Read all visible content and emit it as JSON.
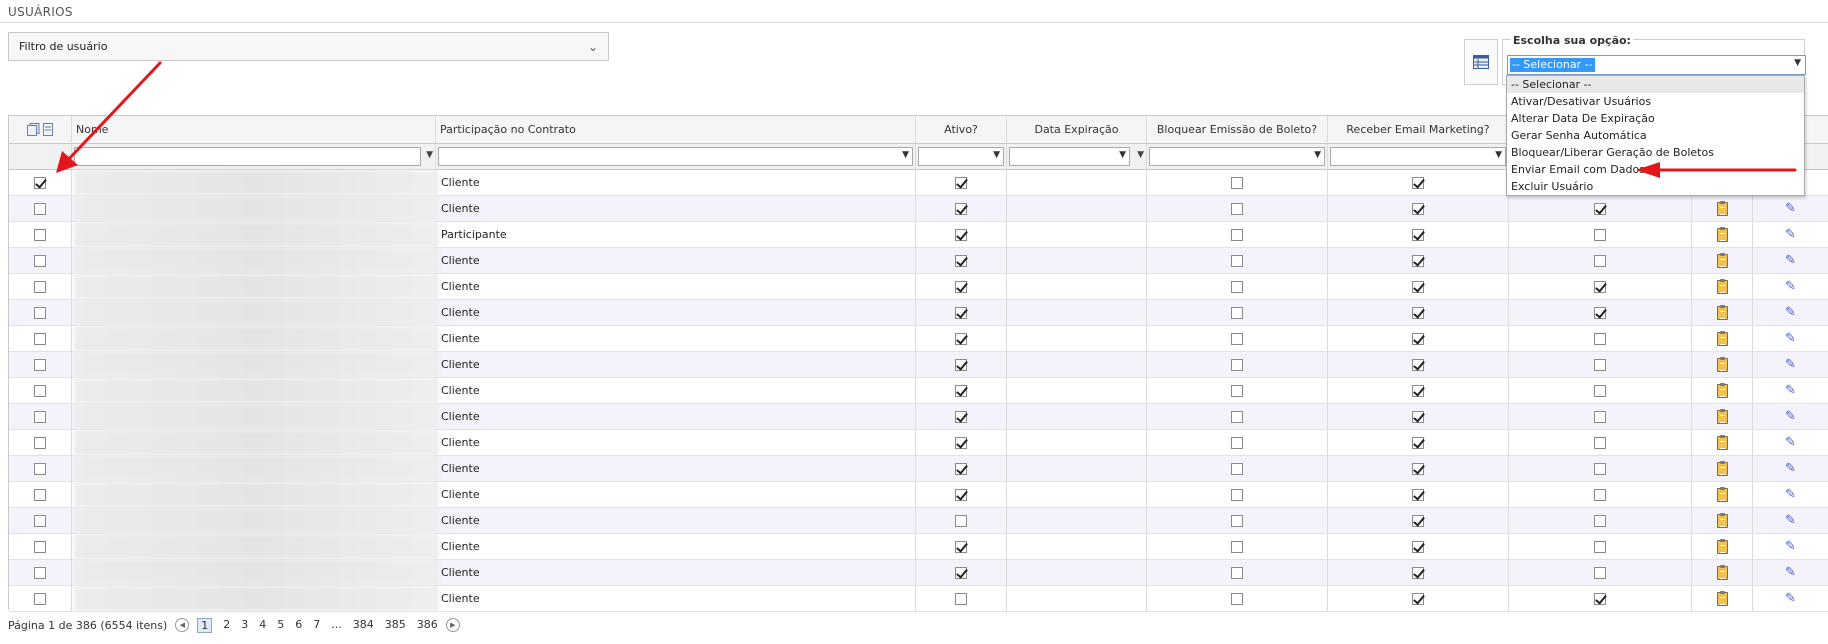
{
  "page": {
    "title": "USUÁRIOS"
  },
  "filter": {
    "label": "Filtro de usuário"
  },
  "options_panel": {
    "legend": "Escolha sua opção:",
    "selected": "-- Selecionar --",
    "items": [
      "-- Selecionar --",
      "Ativar/Desativar Usuários",
      "Alterar Data De Expiração",
      "Gerar Senha Automática",
      "Bloquear/Liberar Geração de Boletos",
      "Enviar Email com Dados",
      "Excluir Usuário"
    ]
  },
  "grid": {
    "columns": {
      "nome": "Nome",
      "participacao": "Participação no Contrato",
      "ativo": "Ativo?",
      "data_expiracao": "Data Expiração",
      "bloquear": "Bloquear Emissão de Boleto?",
      "receber": "Receber Email Marketing?"
    },
    "rows": [
      {
        "sel": true,
        "part": "Cliente",
        "ativo": true,
        "bloq": false,
        "receb": true,
        "extra": false
      },
      {
        "sel": false,
        "part": "Cliente",
        "ativo": true,
        "bloq": false,
        "receb": true,
        "extra": true
      },
      {
        "sel": false,
        "part": "Participante",
        "ativo": true,
        "bloq": false,
        "receb": true,
        "extra": false
      },
      {
        "sel": false,
        "part": "Cliente",
        "ativo": true,
        "bloq": false,
        "receb": true,
        "extra": false
      },
      {
        "sel": false,
        "part": "Cliente",
        "ativo": true,
        "bloq": false,
        "receb": true,
        "extra": true
      },
      {
        "sel": false,
        "part": "Cliente",
        "ativo": true,
        "bloq": false,
        "receb": true,
        "extra": true
      },
      {
        "sel": false,
        "part": "Cliente",
        "ativo": true,
        "bloq": false,
        "receb": true,
        "extra": false
      },
      {
        "sel": false,
        "part": "Cliente",
        "ativo": true,
        "bloq": false,
        "receb": true,
        "extra": false
      },
      {
        "sel": false,
        "part": "Cliente",
        "ativo": true,
        "bloq": false,
        "receb": true,
        "extra": false
      },
      {
        "sel": false,
        "part": "Cliente",
        "ativo": true,
        "bloq": false,
        "receb": true,
        "extra": false
      },
      {
        "sel": false,
        "part": "Cliente",
        "ativo": true,
        "bloq": false,
        "receb": true,
        "extra": false
      },
      {
        "sel": false,
        "part": "Cliente",
        "ativo": true,
        "bloq": false,
        "receb": true,
        "extra": false
      },
      {
        "sel": false,
        "part": "Cliente",
        "ativo": true,
        "bloq": false,
        "receb": true,
        "extra": false
      },
      {
        "sel": false,
        "part": "Cliente",
        "ativo": false,
        "bloq": false,
        "receb": true,
        "extra": false
      },
      {
        "sel": false,
        "part": "Cliente",
        "ativo": true,
        "bloq": false,
        "receb": true,
        "extra": false
      },
      {
        "sel": false,
        "part": "Cliente",
        "ativo": true,
        "bloq": false,
        "receb": true,
        "extra": false
      },
      {
        "sel": false,
        "part": "Cliente",
        "ativo": false,
        "bloq": false,
        "receb": true,
        "extra": true
      }
    ]
  },
  "pager": {
    "summary": "Página 1 de 386 (6554 itens)",
    "pages": [
      "1",
      "2",
      "3",
      "4",
      "5",
      "6",
      "7",
      "...",
      "384",
      "385",
      "386"
    ],
    "current": "1"
  },
  "colors": {
    "annotation_arrow": "#e3161b",
    "selection_highlight": "#3399ff"
  },
  "icons": [
    "table-icon",
    "select-all-icon",
    "copy-icon",
    "filter-icon",
    "clipboard-icon",
    "pencil-icon",
    "prev-page-icon",
    "next-page-icon"
  ]
}
